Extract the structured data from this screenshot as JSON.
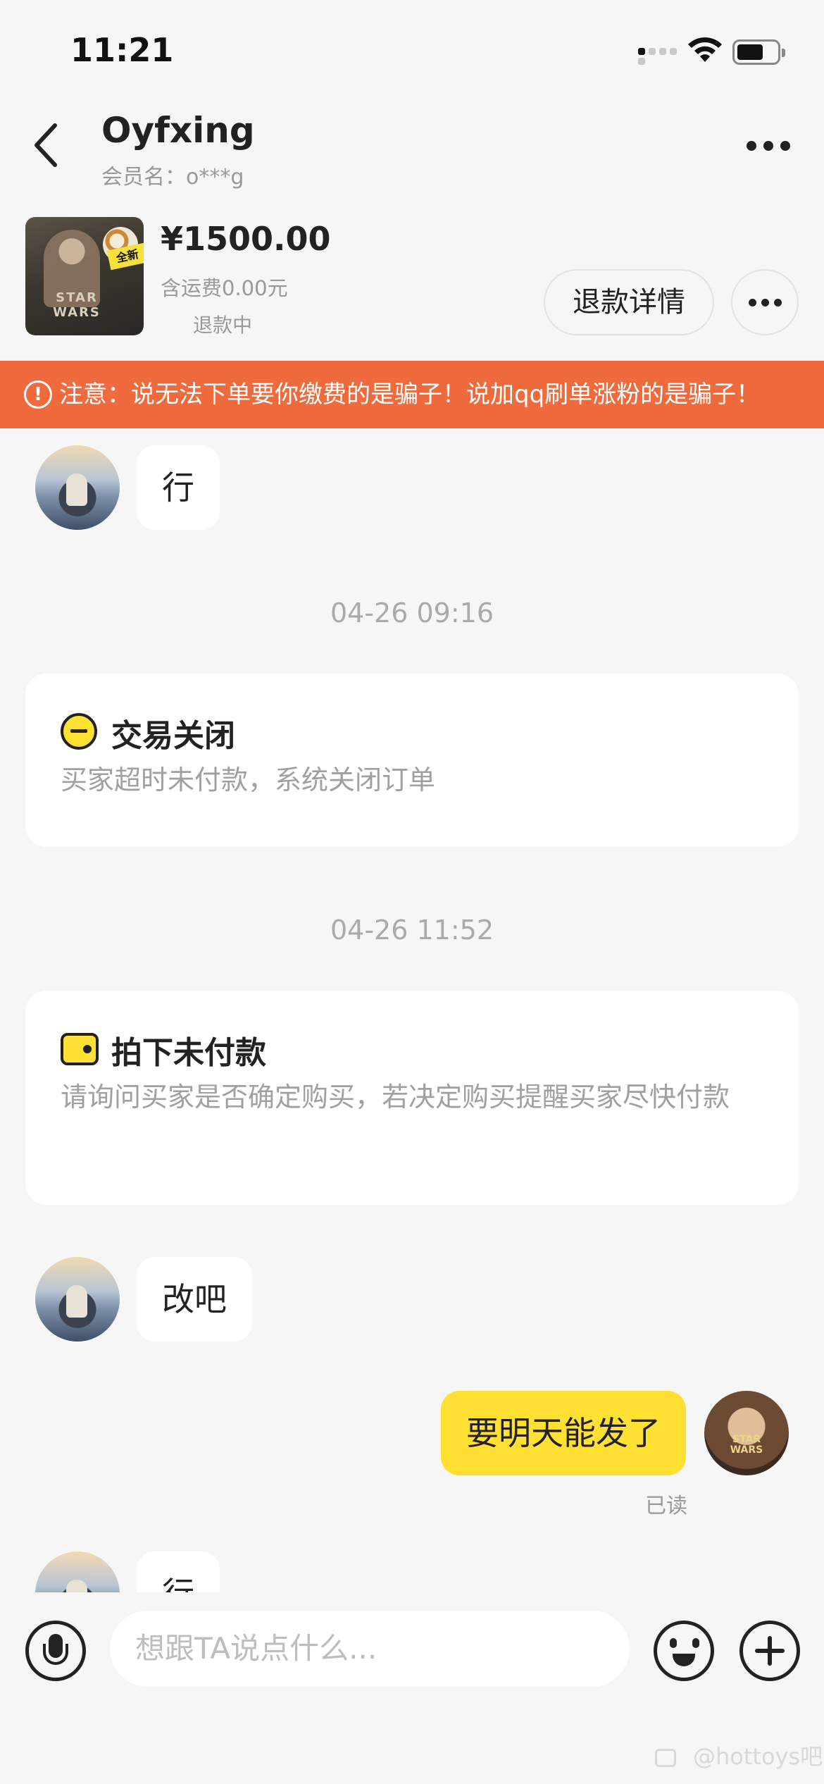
{
  "status_bar": {
    "time": "11:21"
  },
  "header": {
    "title": "Oyfxing",
    "member_name": "会员名：o***g"
  },
  "product": {
    "price": "¥1500.00",
    "shipping": "含运费0.00元",
    "status": "退款中",
    "image_tag": "全新",
    "image_logo": "STAR WARS",
    "refund_detail_label": "退款详情"
  },
  "warning": {
    "icon": "!",
    "text": "注意：说无法下单要你缴费的是骗子！说加qq刷单涨粉的是骗子！"
  },
  "messages": {
    "m1": "行",
    "ts1": "04-26 09:16",
    "card1": {
      "title": "交易关闭",
      "desc": "买家超时未付款，系统关闭订单"
    },
    "ts2": "04-26 11:52",
    "card2": {
      "title": "拍下未付款",
      "desc": "请询问买家是否确定购买，若决定购买提醒买家尽快付款"
    },
    "m2": "改吧",
    "m3": "要明天能发了",
    "read": "已读",
    "m4": "行"
  },
  "input": {
    "placeholder": "想跟TA说点什么..."
  },
  "watermark": "@hottoys吧",
  "colors": {
    "accent_yellow": "#ffe033",
    "warning_orange": "#ef6a3c",
    "background": "#f6f6f6"
  },
  "icons": [
    "back-arrow-icon",
    "more-dots-icon",
    "warning-icon",
    "close-circle-icon",
    "wallet-icon",
    "microphone-icon",
    "emoji-icon",
    "plus-icon"
  ]
}
